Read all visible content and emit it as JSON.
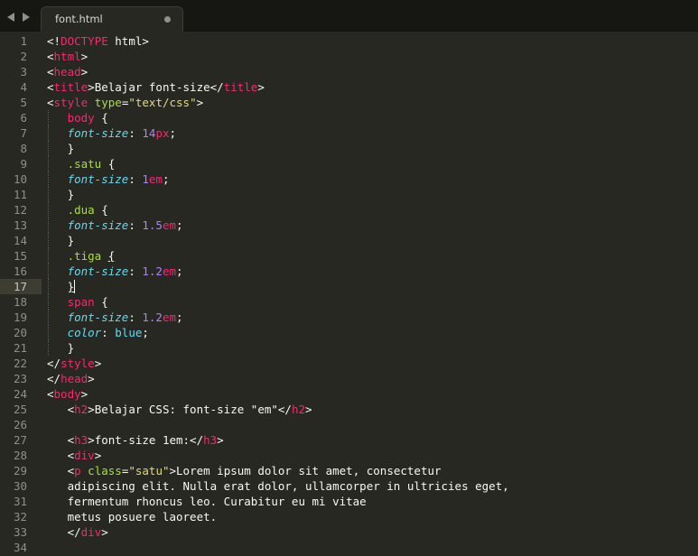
{
  "tabbar": {
    "tab_title": "font.html"
  },
  "editor": {
    "current_line": 17,
    "line_numbers": [
      "1",
      "2",
      "3",
      "4",
      "5",
      "6",
      "7",
      "8",
      "9",
      "10",
      "11",
      "12",
      "13",
      "14",
      "15",
      "16",
      "17",
      "18",
      "19",
      "20",
      "21",
      "22",
      "23",
      "24",
      "25",
      "26",
      "27",
      "28",
      "29",
      "30",
      "31",
      "32",
      "33",
      "34"
    ],
    "lines": [
      [
        {
          "t": "<!",
          "c": "plain"
        },
        {
          "t": "DOCTYPE",
          "c": "tag"
        },
        {
          "t": " html>",
          "c": "plain"
        }
      ],
      [
        {
          "t": "<",
          "c": "plain"
        },
        {
          "t": "html",
          "c": "tag"
        },
        {
          "t": ">",
          "c": "plain"
        }
      ],
      [
        {
          "t": "<",
          "c": "plain"
        },
        {
          "t": "head",
          "c": "tag"
        },
        {
          "t": ">",
          "c": "plain"
        }
      ],
      [
        {
          "t": "<",
          "c": "plain"
        },
        {
          "t": "title",
          "c": "tag"
        },
        {
          "t": ">Belajar font-size</",
          "c": "plain"
        },
        {
          "t": "title",
          "c": "tag"
        },
        {
          "t": ">",
          "c": "plain"
        }
      ],
      [
        {
          "t": "<",
          "c": "plain"
        },
        {
          "t": "style",
          "c": "tag"
        },
        {
          "t": " ",
          "c": "plain"
        },
        {
          "t": "type",
          "c": "attr"
        },
        {
          "t": "=",
          "c": "plain"
        },
        {
          "t": "\"text/css\"",
          "c": "str"
        },
        {
          "t": ">",
          "c": "plain"
        }
      ],
      [
        {
          "t": "   ",
          "c": "plain"
        },
        {
          "t": "body",
          "c": "tag"
        },
        {
          "t": " {",
          "c": "plain"
        }
      ],
      [
        {
          "t": "   ",
          "c": "plain"
        },
        {
          "t": "font-size",
          "c": "prop"
        },
        {
          "t": ": ",
          "c": "plain"
        },
        {
          "t": "14",
          "c": "num"
        },
        {
          "t": "px",
          "c": "unit"
        },
        {
          "t": ";",
          "c": "plain"
        }
      ],
      [
        {
          "t": "   }",
          "c": "plain"
        }
      ],
      [
        {
          "t": "   ",
          "c": "plain"
        },
        {
          "t": ".satu",
          "c": "sel"
        },
        {
          "t": " {",
          "c": "plain"
        }
      ],
      [
        {
          "t": "   ",
          "c": "plain"
        },
        {
          "t": "font-size",
          "c": "prop"
        },
        {
          "t": ": ",
          "c": "plain"
        },
        {
          "t": "1",
          "c": "num"
        },
        {
          "t": "em",
          "c": "unit"
        },
        {
          "t": ";",
          "c": "plain"
        }
      ],
      [
        {
          "t": "   }",
          "c": "plain"
        }
      ],
      [
        {
          "t": "   ",
          "c": "plain"
        },
        {
          "t": ".dua",
          "c": "sel"
        },
        {
          "t": " {",
          "c": "plain"
        }
      ],
      [
        {
          "t": "   ",
          "c": "plain"
        },
        {
          "t": "font-size",
          "c": "prop"
        },
        {
          "t": ": ",
          "c": "plain"
        },
        {
          "t": "1.5",
          "c": "num"
        },
        {
          "t": "em",
          "c": "unit"
        },
        {
          "t": ";",
          "c": "plain"
        }
      ],
      [
        {
          "t": "   }",
          "c": "plain"
        }
      ],
      [
        {
          "t": "   ",
          "c": "plain"
        },
        {
          "t": ".tiga",
          "c": "sel"
        },
        {
          "t": " ",
          "c": "plain"
        },
        {
          "t": "{",
          "c": "bracket"
        }
      ],
      [
        {
          "t": "   ",
          "c": "plain"
        },
        {
          "t": "font-size",
          "c": "prop"
        },
        {
          "t": ": ",
          "c": "plain"
        },
        {
          "t": "1.2",
          "c": "num"
        },
        {
          "t": "em",
          "c": "unit"
        },
        {
          "t": ";",
          "c": "plain"
        }
      ],
      [
        {
          "t": "   ",
          "c": "plain"
        },
        {
          "t": "}",
          "c": "bracket"
        },
        {
          "t": "",
          "c": "caret"
        }
      ],
      [
        {
          "t": "   ",
          "c": "plain"
        },
        {
          "t": "span",
          "c": "tag"
        },
        {
          "t": " {",
          "c": "plain"
        }
      ],
      [
        {
          "t": "   ",
          "c": "plain"
        },
        {
          "t": "font-size",
          "c": "prop"
        },
        {
          "t": ": ",
          "c": "plain"
        },
        {
          "t": "1.2",
          "c": "num"
        },
        {
          "t": "em",
          "c": "unit"
        },
        {
          "t": ";",
          "c": "plain"
        }
      ],
      [
        {
          "t": "   ",
          "c": "plain"
        },
        {
          "t": "color",
          "c": "prop"
        },
        {
          "t": ": ",
          "c": "plain"
        },
        {
          "t": "blue",
          "c": "kw"
        },
        {
          "t": ";",
          "c": "plain"
        }
      ],
      [
        {
          "t": "   }",
          "c": "plain"
        }
      ],
      [
        {
          "t": "</",
          "c": "plain"
        },
        {
          "t": "style",
          "c": "tag"
        },
        {
          "t": ">",
          "c": "plain"
        }
      ],
      [
        {
          "t": "</",
          "c": "plain"
        },
        {
          "t": "head",
          "c": "tag"
        },
        {
          "t": ">",
          "c": "plain"
        }
      ],
      [
        {
          "t": "<",
          "c": "plain"
        },
        {
          "t": "body",
          "c": "tag"
        },
        {
          "t": ">",
          "c": "plain"
        }
      ],
      [
        {
          "t": "   <",
          "c": "plain"
        },
        {
          "t": "h2",
          "c": "tag"
        },
        {
          "t": ">Belajar CSS: font-size \"em\"</",
          "c": "plain"
        },
        {
          "t": "h2",
          "c": "tag"
        },
        {
          "t": ">",
          "c": "plain"
        }
      ],
      [
        {
          "t": "",
          "c": "plain"
        }
      ],
      [
        {
          "t": "   <",
          "c": "plain"
        },
        {
          "t": "h3",
          "c": "tag"
        },
        {
          "t": ">font-size 1em:</",
          "c": "plain"
        },
        {
          "t": "h3",
          "c": "tag"
        },
        {
          "t": ">",
          "c": "plain"
        }
      ],
      [
        {
          "t": "   <",
          "c": "plain"
        },
        {
          "t": "div",
          "c": "tag"
        },
        {
          "t": ">",
          "c": "plain"
        }
      ],
      [
        {
          "t": "   <",
          "c": "plain"
        },
        {
          "t": "p",
          "c": "tag"
        },
        {
          "t": " ",
          "c": "plain"
        },
        {
          "t": "class",
          "c": "attr"
        },
        {
          "t": "=",
          "c": "plain"
        },
        {
          "t": "\"satu\"",
          "c": "str"
        },
        {
          "t": ">Lorem ipsum dolor sit amet, consectetur",
          "c": "plain"
        }
      ],
      [
        {
          "t": "   adipiscing elit. Nulla erat dolor, ullamcorper in ultricies eget,",
          "c": "plain"
        }
      ],
      [
        {
          "t": "   fermentum rhoncus leo. Curabitur eu mi vitae",
          "c": "plain"
        }
      ],
      [
        {
          "t": "   metus posuere laoreet.",
          "c": "plain"
        }
      ],
      [
        {
          "t": "   </",
          "c": "plain"
        },
        {
          "t": "div",
          "c": "tag"
        },
        {
          "t": ">",
          "c": "plain"
        }
      ],
      [
        {
          "t": "",
          "c": "plain"
        }
      ]
    ]
  }
}
